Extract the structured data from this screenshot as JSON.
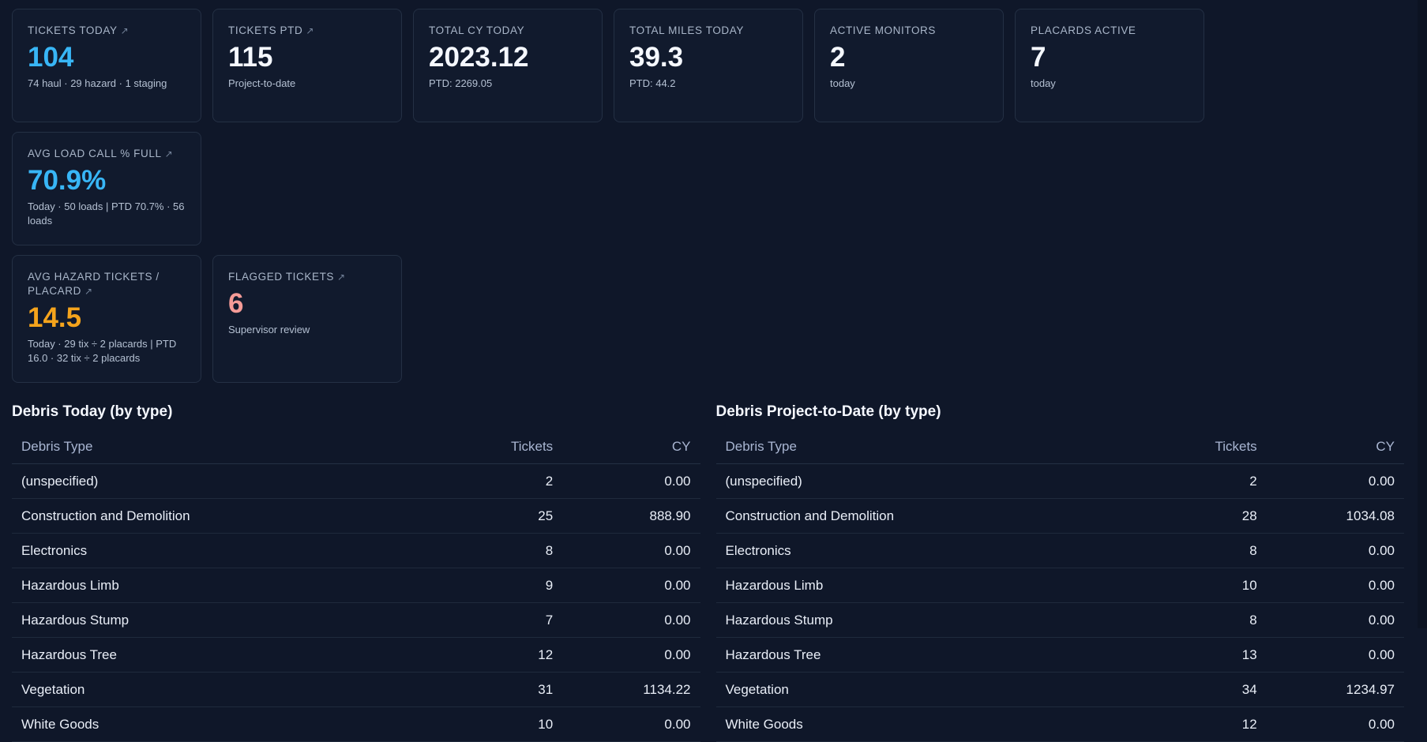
{
  "cards_row1": [
    {
      "title": "TICKETS TODAY",
      "arrow": true,
      "value": "104",
      "value_color": "#38b6f6",
      "sub": "74 haul · 29 hazard · 1 staging"
    },
    {
      "title": "TICKETS PTD",
      "arrow": true,
      "value": "115",
      "value_color": "#f5f8ff",
      "sub": "Project-to-date"
    },
    {
      "title": "TOTAL CY TODAY",
      "arrow": false,
      "value": "2023.12",
      "value_color": "#f5f8ff",
      "sub": "PTD: 2269.05"
    },
    {
      "title": "TOTAL MILES TODAY",
      "arrow": false,
      "value": "39.3",
      "value_color": "#f5f8ff",
      "sub": "PTD: 44.2"
    },
    {
      "title": "ACTIVE MONITORS",
      "arrow": false,
      "value": "2",
      "value_color": "#f5f8ff",
      "sub": "today"
    },
    {
      "title": "PLACARDS ACTIVE",
      "arrow": false,
      "value": "7",
      "value_color": "#f5f8ff",
      "sub": "today"
    },
    {
      "title": "AVG LOAD CALL % FULL",
      "arrow": true,
      "value": "70.9%",
      "value_color": "#38b6f6",
      "sub": "Today · 50 loads | PTD 70.7% · 56 loads"
    }
  ],
  "cards_row2": [
    {
      "title": "AVG HAZARD TICKETS / PLACARD",
      "arrow": true,
      "value": "14.5",
      "value_color": "#f5a41c",
      "sub": "Today · 29 tix ÷ 2 placards | PTD 16.0 · 32 tix ÷ 2 placards"
    },
    {
      "title": "FLAGGED TICKETS",
      "arrow": true,
      "value": "6",
      "value_color": "#f59b97",
      "sub": "Supervisor review"
    }
  ],
  "arrow_glyph": "↗",
  "tables": [
    {
      "title": "Debris Today (by type)",
      "headers": [
        "Debris Type",
        "Tickets",
        "CY"
      ],
      "rows": [
        [
          "(unspecified)",
          "2",
          "0.00"
        ],
        [
          "Construction and Demolition",
          "25",
          "888.90"
        ],
        [
          "Electronics",
          "8",
          "0.00"
        ],
        [
          "Hazardous Limb",
          "9",
          "0.00"
        ],
        [
          "Hazardous Stump",
          "7",
          "0.00"
        ],
        [
          "Hazardous Tree",
          "12",
          "0.00"
        ],
        [
          "Vegetation",
          "31",
          "1134.22"
        ],
        [
          "White Goods",
          "10",
          "0.00"
        ]
      ]
    },
    {
      "title": "Debris Project-to-Date (by type)",
      "headers": [
        "Debris Type",
        "Tickets",
        "CY"
      ],
      "rows": [
        [
          "(unspecified)",
          "2",
          "0.00"
        ],
        [
          "Construction and Demolition",
          "28",
          "1034.08"
        ],
        [
          "Electronics",
          "8",
          "0.00"
        ],
        [
          "Hazardous Limb",
          "10",
          "0.00"
        ],
        [
          "Hazardous Stump",
          "8",
          "0.00"
        ],
        [
          "Hazardous Tree",
          "13",
          "0.00"
        ],
        [
          "Vegetation",
          "34",
          "1234.97"
        ],
        [
          "White Goods",
          "12",
          "0.00"
        ]
      ]
    }
  ]
}
